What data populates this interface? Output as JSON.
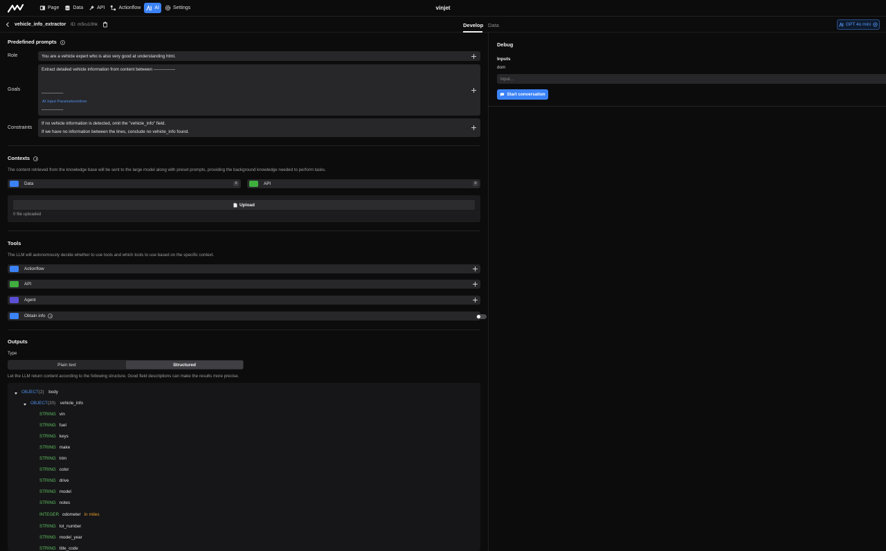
{
  "topbar": {
    "nav": [
      {
        "label": "Page",
        "icon": "page-icon"
      },
      {
        "label": "Data",
        "icon": "database-icon"
      },
      {
        "label": "API",
        "icon": "plug-icon"
      },
      {
        "label": "Actionflow",
        "icon": "flow-icon"
      },
      {
        "label": "AI",
        "icon": "ai-icon",
        "active": true
      },
      {
        "label": "Settings",
        "icon": "gear-icon"
      }
    ],
    "app_title": "vinjet"
  },
  "subbar": {
    "agent_name": "vehicle_info_extractor",
    "agent_id": "ID: m5ru10hk",
    "tabs": [
      {
        "label": "Develop",
        "active": true
      },
      {
        "label": "Data",
        "active": false
      }
    ],
    "model": "GPT 4o mini"
  },
  "prompts": {
    "heading": "Predefined prompts",
    "role_label": "Role",
    "role_value": "You are a vehicle expert who is also very good at understanding html.",
    "goals_label": "Goals",
    "goals_line1": "Extract detailed vehicle information from content between ---------------",
    "goals_line2": "---------------",
    "goals_param": "AI Input Parameters/dom",
    "goals_line3": "---------------",
    "constraints_label": "Constraints",
    "constraints_line1": "If no vehicle information is detected, omit the \"vehicle_info\" field.",
    "constraints_line2": "If we have no information between the lines, conclude no vehicle_info found."
  },
  "contexts": {
    "heading": "Contexts",
    "description": "The content retrieved from the knowledge base will be sent to the large model along with preset prompts, providing the background knowledge needed to perform tasks.",
    "data_label": "Data",
    "data_count": "0",
    "api_label": "API",
    "api_count": "0",
    "upload_label": "Upload",
    "uploaded_text": "0 file uploaded"
  },
  "tools": {
    "heading": "Tools",
    "description": "The LLM will autonomously decide whether to use tools and which tools to use based on the specific context.",
    "items": [
      {
        "label": "Actionflow",
        "color": "#3b82f6"
      },
      {
        "label": "API",
        "color": "#3fae3f"
      },
      {
        "label": "Agent",
        "color": "#5b4fd6"
      },
      {
        "label": "Obtain info",
        "color": "#3b82f6"
      }
    ]
  },
  "outputs": {
    "heading": "Outputs",
    "type_label": "Type",
    "options": [
      "Plain text",
      "Structured"
    ],
    "selected": "Structured",
    "description": "Let the LLM return content according to the following structure. Good field descriptions can make the results more precise.",
    "schema": {
      "root": {
        "type": "OBJECT",
        "count": "(2)",
        "name": "body"
      },
      "child": {
        "type": "OBJECT",
        "count": "(20)",
        "name": "vehicle_info"
      },
      "fields": [
        {
          "type": "STRING",
          "name": "vin"
        },
        {
          "type": "STRING",
          "name": "fuel"
        },
        {
          "type": "STRING",
          "name": "keys"
        },
        {
          "type": "STRING",
          "name": "make"
        },
        {
          "type": "STRING",
          "name": "trim"
        },
        {
          "type": "STRING",
          "name": "color"
        },
        {
          "type": "STRING",
          "name": "drive"
        },
        {
          "type": "STRING",
          "name": "model"
        },
        {
          "type": "STRING",
          "name": "notes"
        },
        {
          "type": "INTEGER",
          "name": "odometer",
          "note": "in miles"
        },
        {
          "type": "STRING",
          "name": "lot_number"
        },
        {
          "type": "STRING",
          "name": "model_year"
        },
        {
          "type": "STRING",
          "name": "title_code"
        }
      ]
    }
  },
  "debug": {
    "heading": "Debug",
    "inputs_label": "Inputs",
    "input_name": "dom",
    "input_placeholder": "Input...",
    "start_label": "Start conversation"
  },
  "colors": {
    "accent": "#3b82f6",
    "type_string": "#5fc15f",
    "type_object": "#4f8fe8",
    "note": "#e59a2a"
  }
}
